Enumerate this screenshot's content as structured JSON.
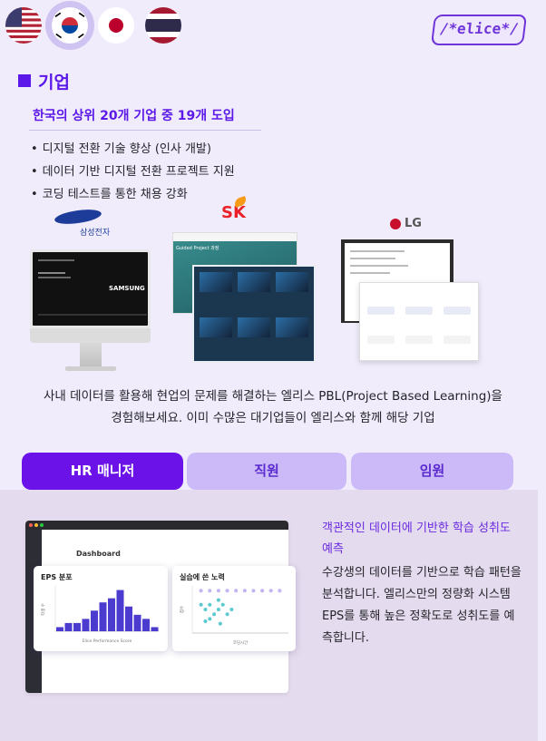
{
  "languages": [
    {
      "name": "English (US)",
      "icon": "us-flag-icon"
    },
    {
      "name": "Korean",
      "icon": "korea-flag-icon",
      "selected": true
    },
    {
      "name": "Japanese",
      "icon": "japan-flag-icon"
    },
    {
      "name": "Thai",
      "icon": "thailand-flag-icon"
    }
  ],
  "logo": {
    "text": "/*elice*/"
  },
  "section": {
    "title": "기업",
    "subtitle": "한국의 상위 20개 기업 중 19개 도입",
    "bullets": [
      "디지털 전환 기술 향상 (인사 개발)",
      "데이터 기반 디지털 전환 프로젝트 지원",
      "코딩 테스트를 통한 채용 강화"
    ]
  },
  "partners": [
    {
      "name": "SAMSUNG",
      "sub": "삼성전자"
    },
    {
      "name": "SK"
    },
    {
      "name": "LG"
    }
  ],
  "screenshots": {
    "samsung_word": "SAMSUNG",
    "sk_heading": "Guided Project 과정"
  },
  "description": "사내 데이터를 활용해 현업의 문제를 해결하는 엘리스 PBL(Project Based Learning)을 경험해보세요. 이미 수많은 대기업들이 엘리스와 함께 해당 기업",
  "tabs": [
    {
      "label": "HR 매니저",
      "active": true
    },
    {
      "label": "직원"
    },
    {
      "label": "임원"
    }
  ],
  "dashboard": {
    "title": "Dashboard",
    "eps_card": {
      "title": "EPS 분포",
      "xlabel": "Elice Performance Score",
      "ylabel": "학생 수"
    },
    "effort_card": {
      "title": "실습에 쓴 노력",
      "xlabel": "코딩시간",
      "ylabel": "점수"
    }
  },
  "chart_data": [
    {
      "type": "bar",
      "title": "EPS 분포",
      "xlabel": "Elice Performance Score",
      "ylabel": "학생 수",
      "values": [
        1,
        2,
        2,
        3,
        5,
        7,
        8,
        10,
        6,
        4,
        3,
        1
      ]
    },
    {
      "type": "scatter",
      "title": "실습에 쓴 노력",
      "xlabel": "코딩시간",
      "ylabel": "점수",
      "series": [
        {
          "values": [
            [
              1,
              9
            ],
            [
              2,
              9
            ],
            [
              3,
              9
            ],
            [
              4,
              9
            ],
            [
              5,
              9
            ],
            [
              6,
              9
            ],
            [
              7,
              9
            ],
            [
              8,
              9
            ],
            [
              9,
              9
            ],
            [
              10,
              9
            ]
          ]
        },
        {
          "values": [
            [
              1,
              6
            ],
            [
              1.5,
              5
            ],
            [
              2,
              6
            ],
            [
              2.5,
              4
            ],
            [
              3,
              7
            ],
            [
              3,
              5
            ],
            [
              3.5,
              6
            ],
            [
              4,
              4
            ],
            [
              4.5,
              5
            ],
            [
              2,
              3
            ],
            [
              1.5,
              2.5
            ],
            [
              3.2,
              2
            ]
          ]
        }
      ]
    }
  ],
  "feature": {
    "title": "객관적인 데이터에 기반한 학습 성취도 예측",
    "body": "수강생의 데이터를 기반으로 학습 패턴을 분석합니다. 엘리스만의 정량화 시스템 EPS를 통해 높은 정확도로 성취도를 예측합니다."
  }
}
